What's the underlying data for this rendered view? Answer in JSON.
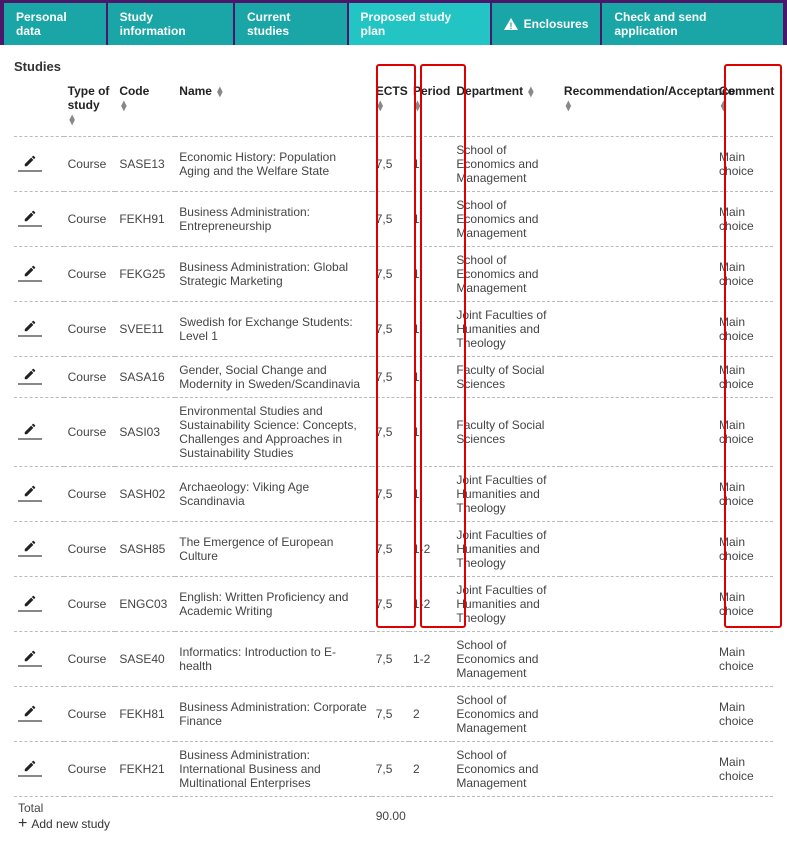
{
  "tabs": [
    {
      "label": "Personal data"
    },
    {
      "label": "Study information"
    },
    {
      "label": "Current studies"
    },
    {
      "label": "Proposed study plan",
      "active": true
    },
    {
      "label": "Enclosures",
      "warn": true
    },
    {
      "label": "Check and send application"
    }
  ],
  "section_title": "Studies",
  "columns": {
    "type": "Type of study",
    "code": "Code",
    "name": "Name",
    "ects": "ECTS",
    "period": "Period",
    "dept": "Department",
    "rec": "Recommendation/Acceptance",
    "comm": "Comment"
  },
  "rows": [
    {
      "type": "Course",
      "code": "SASE13",
      "name": "Economic History: Population Aging and the Welfare State",
      "ects": "7,5",
      "period": "1",
      "dept": "School of Economics and Management",
      "rec": "",
      "comm": "Main choice"
    },
    {
      "type": "Course",
      "code": "FEKH91",
      "name": "Business Administration: Entrepreneurship",
      "ects": "7,5",
      "period": "1",
      "dept": "School of Economics and Management",
      "rec": "",
      "comm": "Main choice"
    },
    {
      "type": "Course",
      "code": "FEKG25",
      "name": "Business Administration: Global Strategic Marketing",
      "ects": "7,5",
      "period": "1",
      "dept": "School of Economics and Management",
      "rec": "",
      "comm": "Main choice"
    },
    {
      "type": "Course",
      "code": "SVEE11",
      "name": "Swedish for Exchange Students: Level 1",
      "ects": "7,5",
      "period": "1",
      "dept": "Joint Faculties of Humanities and Theology",
      "rec": "",
      "comm": "Main choice"
    },
    {
      "type": "Course",
      "code": "SASA16",
      "name": "Gender, Social Change and Modernity in Sweden/Scandinavia",
      "ects": "7,5",
      "period": "1",
      "dept": "Faculty of Social Sciences",
      "rec": "",
      "comm": "Main choice"
    },
    {
      "type": "Course",
      "code": "SASI03",
      "name": "Environmental Studies and Sustainability Science: Concepts, Challenges and Approaches in Sustainability Studies",
      "ects": "7,5",
      "period": "1",
      "dept": "Faculty of Social Sciences",
      "rec": "",
      "comm": "Main choice"
    },
    {
      "type": "Course",
      "code": "SASH02",
      "name": "Archaeology: Viking Age Scandinavia",
      "ects": "7,5",
      "period": "1",
      "dept": "Joint Faculties of Humanities and Theology",
      "rec": "",
      "comm": "Main choice"
    },
    {
      "type": "Course",
      "code": "SASH85",
      "name": "The Emergence of European Culture",
      "ects": "7,5",
      "period": "1-2",
      "dept": "Joint Faculties of Humanities and Theology",
      "rec": "",
      "comm": "Main choice"
    },
    {
      "type": "Course",
      "code": "ENGC03",
      "name": "English: Written Proficiency and Academic Writing",
      "ects": "7,5",
      "period": "1-2",
      "dept": "Joint Faculties of Humanities and Theology",
      "rec": "",
      "comm": "Main choice"
    },
    {
      "type": "Course",
      "code": "SASE40",
      "name": "Informatics: Introduction to E-health",
      "ects": "7,5",
      "period": "1-2",
      "dept": "School of Economics and Management",
      "rec": "",
      "comm": "Main choice"
    },
    {
      "type": "Course",
      "code": "FEKH81",
      "name": "Business Administration: Corporate Finance",
      "ects": "7,5",
      "period": "2",
      "dept": "School of Economics and Management",
      "rec": "",
      "comm": "Main choice"
    },
    {
      "type": "Course",
      "code": "FEKH21",
      "name": "Business Administration: International Business and Multinational Enterprises",
      "ects": "7,5",
      "period": "2",
      "dept": "School of Economics and Management",
      "rec": "",
      "comm": "Main choice"
    }
  ],
  "total_label": "Total",
  "total_ects": "90.00",
  "add_label": "Add new study"
}
